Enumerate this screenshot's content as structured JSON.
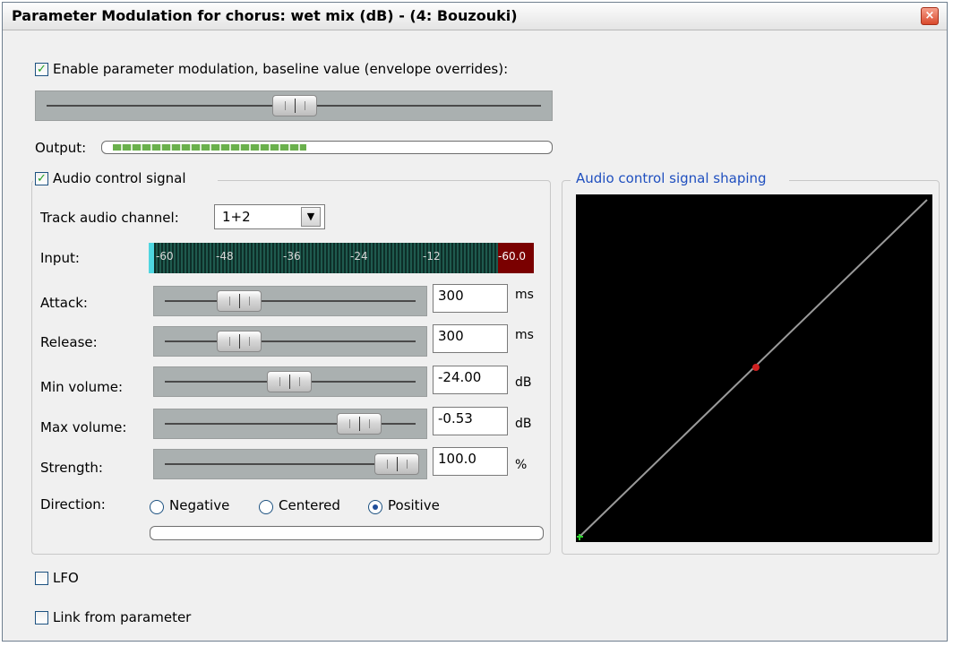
{
  "window": {
    "title": "Parameter Modulation for chorus: wet mix (dB) - (4: Bouzouki)",
    "close_glyph": "×"
  },
  "baseline": {
    "enable_label": "Enable parameter modulation, baseline value (envelope overrides):",
    "enabled": true,
    "slider_value": 0.48
  },
  "output": {
    "label": "Output:",
    "level": 0.45
  },
  "audio_control": {
    "group_label": "Audio control signal",
    "enabled": true,
    "track_channel": {
      "label": "Track audio channel:",
      "value": "1+2"
    },
    "input": {
      "label": "Input:",
      "ticks": [
        "-60",
        "-48",
        "-36",
        "-24",
        "-12"
      ],
      "peak_value": "-60.0"
    },
    "attack": {
      "label": "Attack:",
      "value": "300",
      "unit": "ms",
      "slider": 0.2
    },
    "release": {
      "label": "Release:",
      "value": "300",
      "unit": "ms",
      "slider": 0.2
    },
    "min_volume": {
      "label": "Min volume:",
      "value": "-24.00",
      "unit": "dB",
      "slider": 0.5
    },
    "max_volume": {
      "label": "Max volume:",
      "value": "-0.53",
      "unit": "dB",
      "slider": 0.8
    },
    "strength": {
      "label": "Strength:",
      "value": "100.0",
      "unit": "%",
      "slider": 1.0
    },
    "direction": {
      "label": "Direction:",
      "options": [
        "Negative",
        "Centered",
        "Positive"
      ],
      "selected": "Positive"
    }
  },
  "shaping": {
    "label": "Audio control signal shaping"
  },
  "lfo": {
    "label": "LFO",
    "enabled": false
  },
  "link": {
    "label": "Link from parameter",
    "enabled": false
  },
  "colors": {
    "accent_blue": "#1f4fbf",
    "check_green": "#21a121",
    "meter_green": "#6ab04c",
    "meter_red": "#7a0000"
  }
}
